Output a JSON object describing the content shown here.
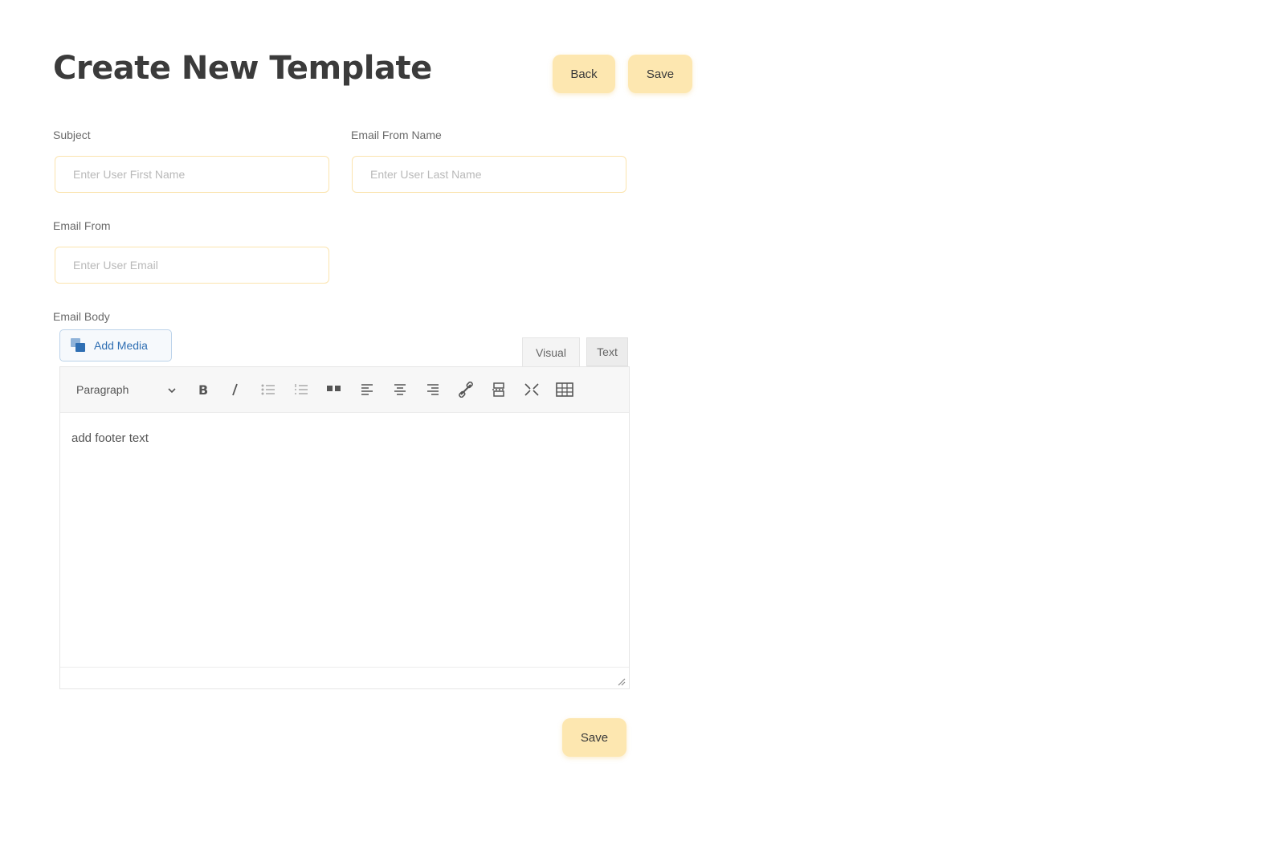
{
  "page": {
    "title": "Create New Template",
    "back_label": "Back",
    "save_label": "Save"
  },
  "form": {
    "subject": {
      "label": "Subject",
      "placeholder": "Enter User First Name",
      "value": ""
    },
    "email_from_name": {
      "label": "Email From Name",
      "placeholder": "Enter User Last Name",
      "value": ""
    },
    "email_from": {
      "label": "Email From",
      "placeholder": "Enter User Email",
      "value": ""
    },
    "email_body": {
      "label": "Email Body"
    }
  },
  "editor": {
    "add_media_label": "Add Media",
    "tabs": [
      "Visual",
      "Text"
    ],
    "format_selected": "Paragraph",
    "toolbar_icons": [
      "bold-icon",
      "italic-icon",
      "bullet-list-icon",
      "numbered-list-icon",
      "blockquote-icon",
      "align-left-icon",
      "align-center-icon",
      "align-right-icon",
      "link-icon",
      "read-more-icon",
      "fullscreen-icon",
      "toolbar-toggle-icon"
    ],
    "content": "add footer text"
  },
  "colors": {
    "button_bg": "#fde7b0",
    "input_border": "#fbe4ae",
    "media_link": "#2f6fb3"
  }
}
